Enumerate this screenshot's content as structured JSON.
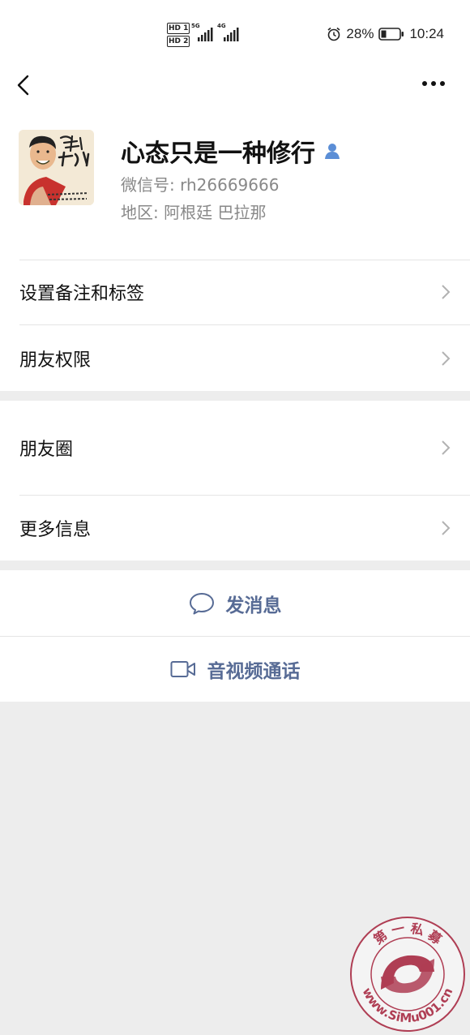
{
  "status_bar": {
    "hd1": "HD 1",
    "hd2": "HD 2",
    "net1": "5G",
    "net2": "4G",
    "battery": "28%",
    "time": "10:24"
  },
  "profile": {
    "nickname": "心态只是一种修行",
    "wechat_id": "微信号: rh26669666",
    "region": "地区: 阿根廷  巴拉那"
  },
  "menu": {
    "remark_tags": "设置备注和标签",
    "friend_permissions": "朋友权限",
    "moments": "朋友圈",
    "more_info": "更多信息"
  },
  "actions": {
    "send_message": "发消息",
    "video_call": "音视频通话"
  },
  "watermark": {
    "text_top": "第 一 私 募",
    "text_bottom": "www.SiMu001.cn"
  },
  "colors": {
    "link": "#576b95",
    "background": "#ededed",
    "watermark_red": "#a5203a"
  }
}
